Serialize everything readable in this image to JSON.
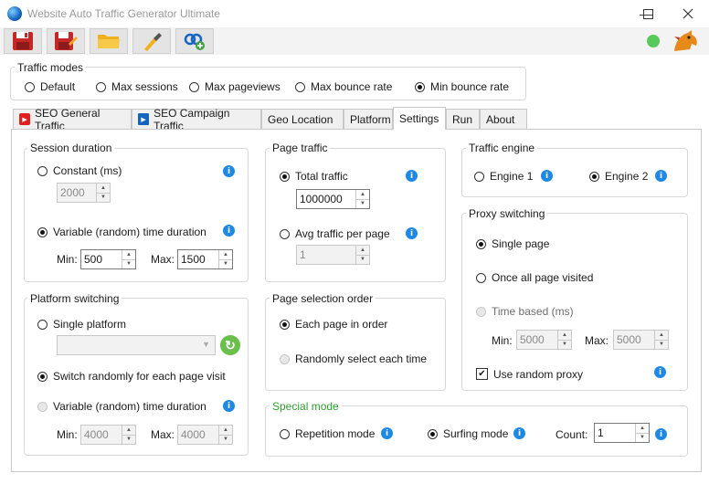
{
  "window": {
    "title": "Website Auto Traffic Generator Ultimate"
  },
  "traffic_modes": {
    "legend": "Traffic modes",
    "options": [
      "Default",
      "Max sessions",
      "Max pageviews",
      "Max bounce rate",
      "Min bounce rate"
    ],
    "selected": "Min bounce rate"
  },
  "tabs": [
    "SEO General Traffic",
    "SEO Campaign Traffic",
    "Geo Location",
    "Platform",
    "Settings",
    "Run",
    "About"
  ],
  "active_tab": "Settings",
  "session_duration": {
    "legend": "Session duration",
    "constant_label": "Constant (ms)",
    "constant_value": "2000",
    "variable_label": "Variable (random) time duration",
    "min_label": "Min:",
    "min_value": "500",
    "max_label": "Max:",
    "max_value": "1500"
  },
  "page_traffic": {
    "legend": "Page traffic",
    "total_label": "Total traffic",
    "total_value": "1000000",
    "avg_label": "Avg traffic per page",
    "avg_value": "1"
  },
  "traffic_engine": {
    "legend": "Traffic engine",
    "engine1": "Engine 1",
    "engine2": "Engine 2",
    "selected": "Engine 2"
  },
  "proxy_switching": {
    "legend": "Proxy switching",
    "single_page": "Single page",
    "once_all": "Once all page visited",
    "time_based": "Time based (ms)",
    "min_label": "Min:",
    "min_value": "5000",
    "max_label": "Max:",
    "max_value": "5000",
    "random_proxy_label": "Use random proxy",
    "random_proxy_checked": true
  },
  "platform_switching": {
    "legend": "Platform switching",
    "single_label": "Single platform",
    "random_label": "Switch randomly for each page visit",
    "variable_label": "Variable (random) time duration",
    "min_label": "Min:",
    "min_value": "4000",
    "max_label": "Max:",
    "max_value": "4000"
  },
  "page_selection": {
    "legend": "Page selection order",
    "each_label": "Each page in order",
    "random_label": "Randomly select each time"
  },
  "special_mode": {
    "legend": "Special mode",
    "repetition_label": "Repetition mode",
    "surfing_label": "Surfing mode",
    "count_label": "Count:",
    "count_value": "1",
    "legend_color": "#2e9e2e"
  },
  "info_glyph": "i",
  "icons": [
    "save-icon",
    "save-as-icon",
    "folder-open-icon",
    "clear-brush-icon",
    "link-add-icon",
    "status-indicator",
    "dragon-logo-icon"
  ]
}
